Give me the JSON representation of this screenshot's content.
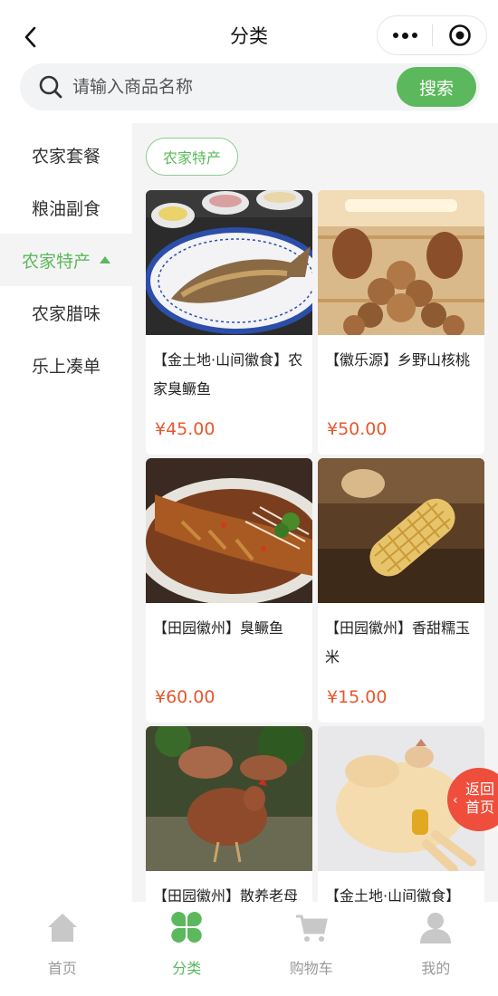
{
  "header": {
    "title": "分类"
  },
  "search": {
    "placeholder": "请输入商品名称",
    "button_label": "搜索"
  },
  "sidebar": {
    "items": [
      {
        "label": "农家套餐",
        "active": false
      },
      {
        "label": "粮油副食",
        "active": false
      },
      {
        "label": "农家特产",
        "active": true
      },
      {
        "label": "农家腊味",
        "active": false
      },
      {
        "label": "乐上凑单",
        "active": false
      }
    ]
  },
  "content": {
    "subcategory": "农家特产",
    "products": [
      {
        "name": "【金土地·山间徽食】农家臭鳜鱼",
        "price": "¥45.00",
        "image": "stinky-mandarin-fish-on-blue-plate"
      },
      {
        "name": "【徽乐源】乡野山核桃",
        "price": "¥50.00",
        "image": "walnuts-in-oven"
      },
      {
        "name": "【田园徽州】臭鳜鱼",
        "price": "¥60.00",
        "image": "braised-fish-with-vegetables"
      },
      {
        "name": "【田园徽州】香甜糯玉米",
        "price": "¥15.00",
        "image": "sweet-waxy-corn"
      },
      {
        "name": "【田园徽州】散养老母",
        "price": "",
        "image": "free-range-hen"
      },
      {
        "name": "【金土地·山间徽食】",
        "price": "",
        "image": "whole-chicken"
      }
    ]
  },
  "float_button": {
    "label": "返回首页"
  },
  "tabbar": {
    "items": [
      {
        "label": "首页",
        "icon": "home-icon",
        "active": false
      },
      {
        "label": "分类",
        "icon": "category-clover-icon",
        "active": true
      },
      {
        "label": "购物车",
        "icon": "cart-icon",
        "active": false
      },
      {
        "label": "我的",
        "icon": "user-icon",
        "active": false
      }
    ]
  },
  "colors": {
    "accent": "#5cb85c",
    "price": "#e8572c",
    "float": "#ee4e3b",
    "inactive": "#c8c8c8"
  }
}
